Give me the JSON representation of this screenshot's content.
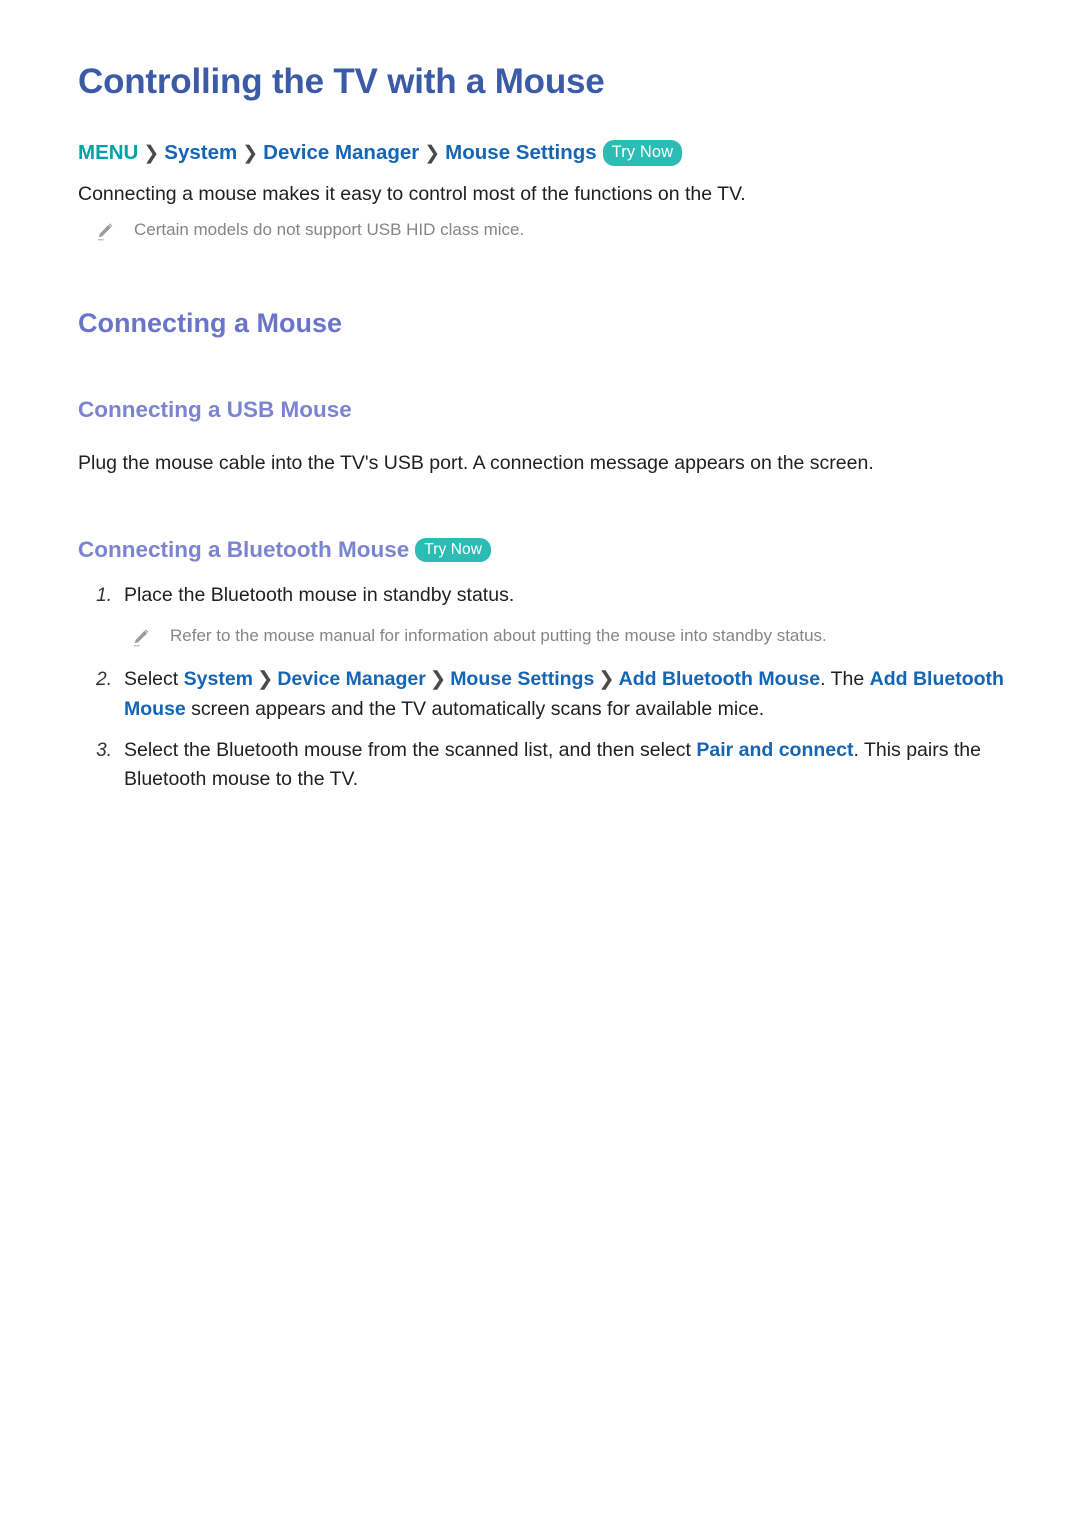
{
  "document": {
    "title": "Controlling the TV with a Mouse"
  },
  "breadcrumb": {
    "menu": "MENU",
    "separator": "❯",
    "items": [
      "System",
      "Device Manager",
      "Mouse Settings"
    ],
    "try_now_label": "Try Now"
  },
  "intro": {
    "paragraph": "Connecting a mouse makes it easy to control most of the functions on the TV.",
    "note": "Certain models do not support USB HID class mice.",
    "note_icon": "pencil-icon"
  },
  "sections": {
    "connecting_a_mouse": {
      "heading": "Connecting a Mouse"
    },
    "usb": {
      "heading": "Connecting a USB Mouse",
      "paragraph": "Plug the mouse cable into the TV's USB port. A connection message appears on the screen."
    },
    "bluetooth": {
      "heading": "Connecting a Bluetooth Mouse",
      "try_now_label": "Try Now",
      "steps": [
        {
          "num": "1.",
          "text": "Place the Bluetooth mouse in standby status.",
          "note": "Refer to the mouse manual for information about putting the mouse into standby status.",
          "note_icon": "pencil-icon"
        },
        {
          "num": "2.",
          "parts": {
            "lead": "Select ",
            "link1": "System",
            "link2": "Device Manager",
            "link3": "Mouse Settings",
            "link4": "Add Bluetooth Mouse",
            "mid": ". The ",
            "link5": "Add Bluetooth Mouse",
            "tail": " screen appears and the TV automatically scans for available mice."
          }
        },
        {
          "num": "3.",
          "parts": {
            "lead": "Select the Bluetooth mouse from the scanned list, and then select ",
            "link1": "Pair and connect",
            "tail": ". This pairs the Bluetooth mouse to the TV."
          }
        }
      ]
    }
  },
  "colors": {
    "title_blue": "#3b5aa8",
    "heading_purple": "#6a74c9",
    "subheading_purple": "#7b84d0",
    "link_blue": "#1565b5",
    "menu_teal": "#00a2a8",
    "badge_teal": "#2cbcb4",
    "note_gray": "#858585",
    "body_black": "#1f1f1f"
  }
}
